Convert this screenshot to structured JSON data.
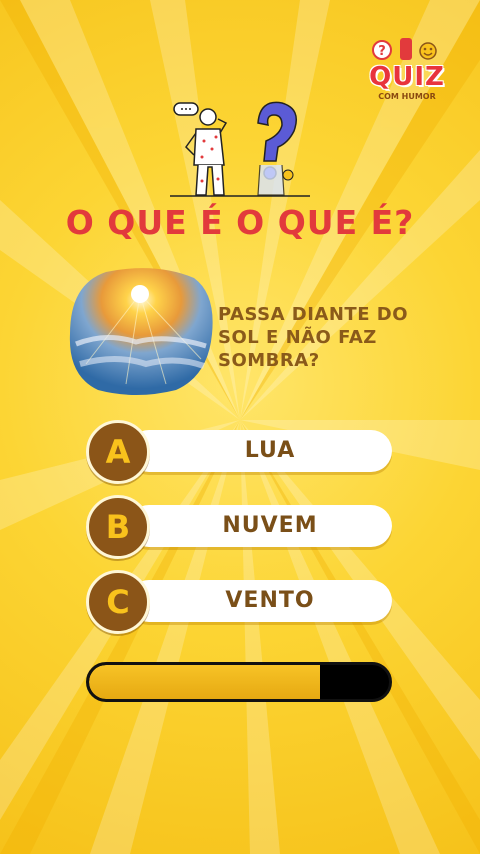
{
  "logo": {
    "text": "QUIZ",
    "subtitle": "COM HUMOR"
  },
  "title": "O QUE É O QUE É?",
  "question": {
    "text": "PASSA DIANTE DO SOL E NÃO FAZ SOMBRA?"
  },
  "options": [
    {
      "letter": "A",
      "label": "LUA"
    },
    {
      "letter": "B",
      "label": "NUVEM"
    },
    {
      "letter": "C",
      "label": "VENTO"
    }
  ],
  "timer": {
    "progress": 0.77
  },
  "colors": {
    "background": "#fcd534",
    "title": "#e23a3c",
    "question_text": "#8a5a1a",
    "option_circle": "#8b5518",
    "option_letter": "#f9c21c",
    "progress_fill": "#f7c326"
  },
  "icons": [
    "thinking-person-icon",
    "question-mark-icon",
    "quiz-logo-icon",
    "sun-cloud-image"
  ]
}
